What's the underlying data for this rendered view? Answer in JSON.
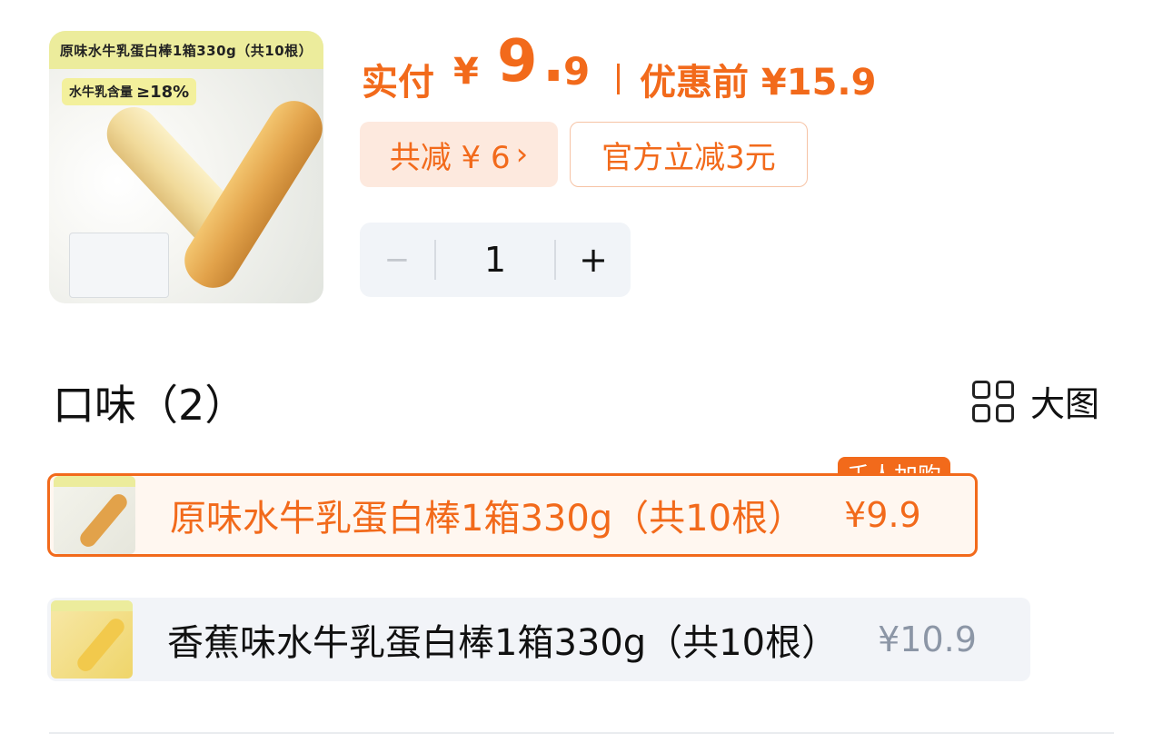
{
  "product": {
    "thumbnail_banner": "原味水牛乳蛋白棒1箱330g（共10根）",
    "thumbnail_tag_text": "水牛乳含量",
    "thumbnail_tag_value": "≥18%"
  },
  "price": {
    "pay_label": "实付",
    "currency": "¥",
    "pay_integer": "9",
    "pay_dot": ".",
    "pay_decimal": "9",
    "original_label": "优惠前 ¥15.9"
  },
  "coupons": {
    "total_discount": "共减 ¥ 6",
    "total_discount_arrow": "›",
    "official_discount": "官方立减3元"
  },
  "quantity": {
    "minus": "−",
    "value": "1",
    "plus": "+"
  },
  "flavor": {
    "title": "口味（2）",
    "view_toggle": "大图",
    "options": [
      {
        "name": "原味水牛乳蛋白棒1箱330g（共10根）",
        "price": "¥9.9",
        "badge": "千人加购",
        "selected": true
      },
      {
        "name": "香蕉味水牛乳蛋白棒1箱330g（共10根）",
        "price": "¥10.9",
        "selected": false
      }
    ]
  },
  "colors": {
    "accent": "#f26a1b",
    "chip_bg": "#fde9de",
    "stepper_bg": "#f1f4f8",
    "option_bg": "#f2f4f8"
  }
}
